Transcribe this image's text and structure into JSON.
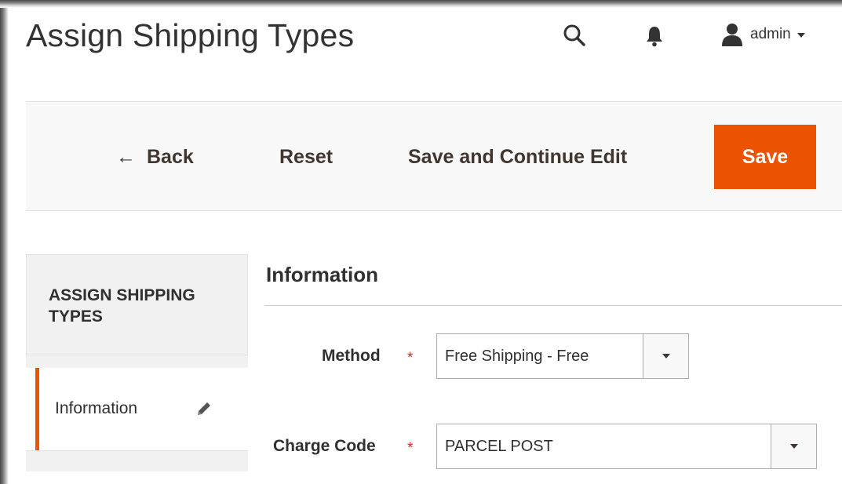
{
  "header": {
    "page_title": "Assign Shipping Types",
    "user_name": "admin"
  },
  "toolbar": {
    "back_label": "Back",
    "reset_label": "Reset",
    "save_continue_label": "Save and Continue Edit",
    "save_label": "Save"
  },
  "sidebar": {
    "title": "ASSIGN SHIPPING TYPES",
    "items": [
      {
        "label": "Information"
      }
    ]
  },
  "form": {
    "section_title": "Information",
    "required_mark": "*",
    "fields": [
      {
        "label": "Method",
        "value": "Free Shipping - Free"
      },
      {
        "label": "Charge Code",
        "value": "PARCEL POST"
      }
    ]
  },
  "icons": {
    "search": "search-icon",
    "notifications": "bell-icon",
    "user": "user-icon",
    "edit": "pencil-icon",
    "back": "arrow-left-icon"
  },
  "colors": {
    "accent": "#eb5202",
    "required": "#e22626",
    "toolbar_bg": "#f8f8f8",
    "sidebar_bg": "#f1f1f1"
  }
}
